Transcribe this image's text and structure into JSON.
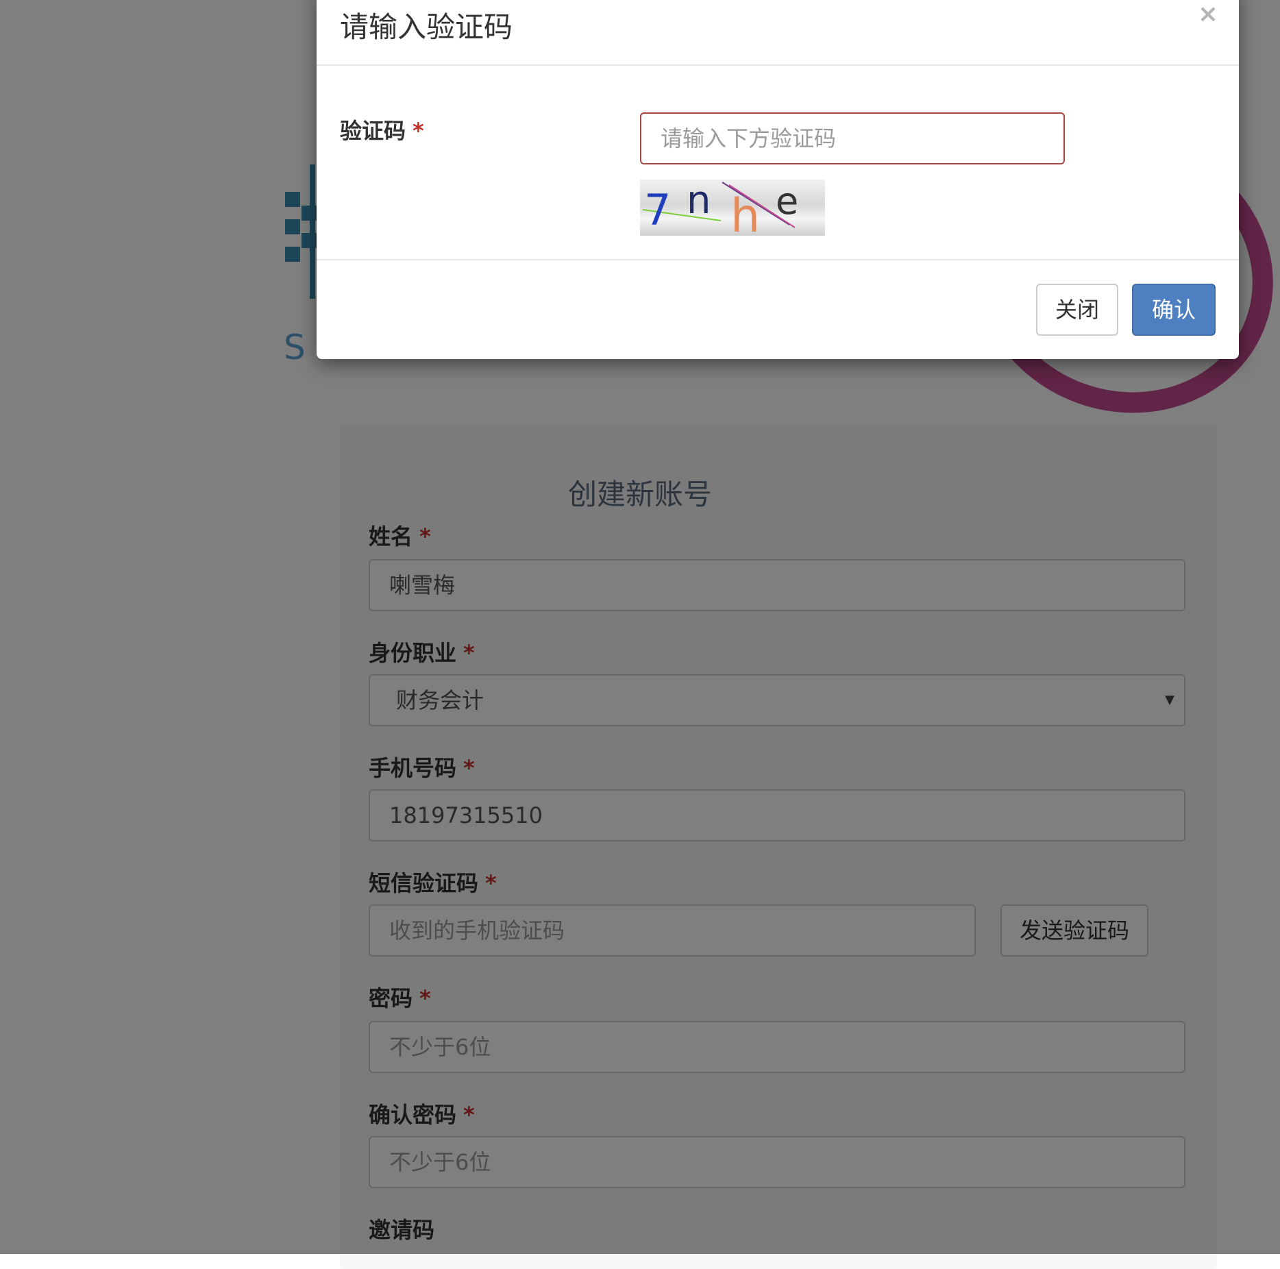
{
  "modal": {
    "title": "请输入验证码",
    "close_icon": "×",
    "captcha_label": "验证码",
    "required_mark": "*",
    "captcha_placeholder": "请输入下方验证码",
    "captcha_chars": [
      "7",
      "n",
      "h",
      "e"
    ],
    "close_button": "关闭",
    "confirm_button": "确认"
  },
  "background": {
    "logo_letter": "S",
    "form_title": "创建新账号",
    "fields": {
      "name": {
        "label": "姓名",
        "value": "喇雪梅"
      },
      "occupation": {
        "label": "身份职业",
        "value": "财务会计"
      },
      "phone": {
        "label": "手机号码",
        "value": "18197315510"
      },
      "sms": {
        "label": "短信验证码",
        "placeholder": "收到的手机验证码",
        "send_button": "发送验证码"
      },
      "password": {
        "label": "密码",
        "placeholder": "不少于6位"
      },
      "confirm_password": {
        "label": "确认密码",
        "placeholder": "不少于6位"
      },
      "invite": {
        "label": "邀请码"
      }
    },
    "required_mark": "*"
  },
  "colors": {
    "accent_blue": "#4e7fc0",
    "error_red": "#a94442",
    "required_red": "#c9302c",
    "backdrop": "rgba(0,0,0,0.5)"
  }
}
